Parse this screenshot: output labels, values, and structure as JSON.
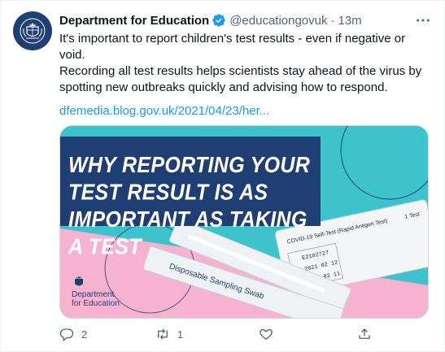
{
  "tweet": {
    "author_name": "Department for Education",
    "handle": "@educationgovuk",
    "separator": "·",
    "time": "13m",
    "paragraph1": "It's important to report children's test results - even if negative or void.",
    "paragraph2": "Recording all test results helps scientists stay ahead of the virus by spotting new outbreaks quickly and advising how to respond.",
    "link": "dfemedia.blog.gov.uk/2021/04/23/her..."
  },
  "card": {
    "headline": "WHY REPORTING YOUR TEST RESULT IS AS IMPORTANT AS TAKING A TEST",
    "test_kit_label": "COVID-19 Self-Test (Rapid Antigen Test)",
    "test_kit_count": "1 Test",
    "lot_number": "E2102727",
    "date1": "2021 02 12",
    "date2": "2023 02 11",
    "swab_label": "Disposable Sampling Swab",
    "logo_line1": "Department",
    "logo_line2": "for Education"
  },
  "actions": {
    "reply_count": "2",
    "retweet_count": "1",
    "like_count": "",
    "share_count": ""
  },
  "colors": {
    "link": "#1d9bf0",
    "verified": "#1d9bf0",
    "navy": "#1f3f73",
    "teal": "#3cc3cc",
    "pink": "#f6b3cf"
  },
  "icons": [
    "crest-avatar-icon",
    "verified-badge-icon",
    "more-icon",
    "reply-icon",
    "retweet-icon",
    "like-icon",
    "share-icon"
  ]
}
